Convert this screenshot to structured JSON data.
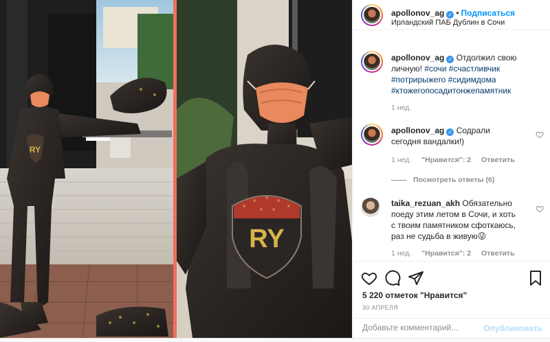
{
  "header": {
    "username": "apollonov_ag",
    "follow_label": "Подписаться",
    "separator": "•",
    "location": "Ирландский ПАБ Дублин в Сочи"
  },
  "caption": {
    "username": "apollonov_ag",
    "text": "Отдолжил свою личную!",
    "hashtags": [
      "#сочи",
      "#счастливчик",
      "#потрирыжего",
      "#сидимдома",
      "#ктожегопосадитонжепамятник"
    ],
    "time": "1 нед."
  },
  "comments": [
    {
      "username": "apollonov_ag",
      "text": "Содрали сегодня вандалки!)",
      "time": "1 нед.",
      "likes_label": "\"Нравится\": 2",
      "reply_label": "Ответить",
      "view_replies": "Посмотреть ответы (6)"
    },
    {
      "username": "taika_rezuan_akh",
      "text": "Обязательно поеду этим летом в Сочи, и хоть с твоим памятником сфоткаюсь, раз не судьба в живую😜",
      "time": "1 нед.",
      "likes_label": "\"Нравится\": 2",
      "reply_label": "Ответить"
    }
  ],
  "actions": {
    "likes_text": "5 220 отметок \"Нравится\"",
    "date": "30 АПРЕЛЯ",
    "comment_placeholder": "Добавьте комментарий...",
    "publish_label": "Опубликовать"
  },
  "photo": {
    "shirt_letters": "RY"
  },
  "colors": {
    "link_blue": "#0095f6",
    "hashtag": "#00376b",
    "muted": "#8e8e8e",
    "verified": "#3897f0",
    "mask": "#e8895e",
    "photo_divider": "#ef6f5e"
  },
  "icons": [
    "verified-badge-icon",
    "heart-icon",
    "comment-icon",
    "share-icon",
    "bookmark-icon"
  ]
}
